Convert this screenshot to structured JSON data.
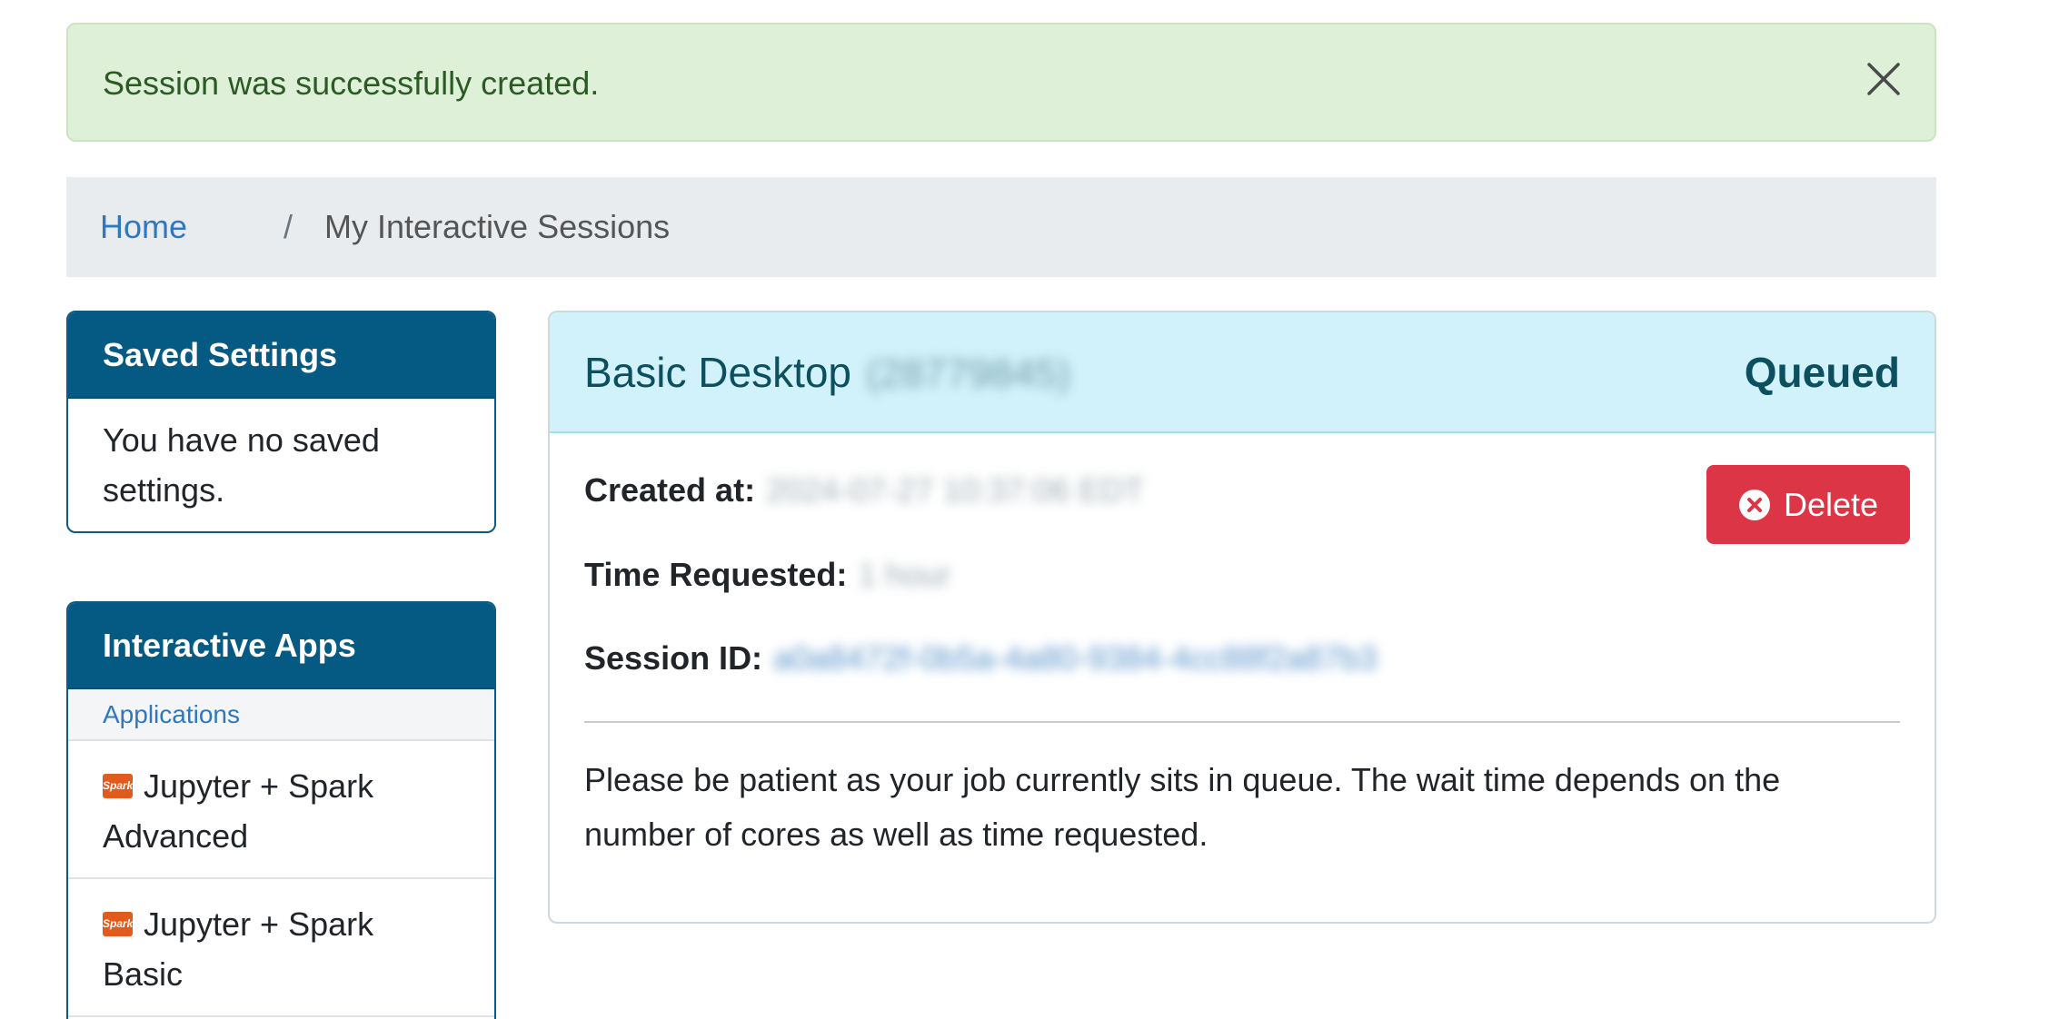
{
  "alert": {
    "message": "Session was successfully created.",
    "close_icon": "close-icon"
  },
  "breadcrumb": {
    "home": "Home",
    "separator": "/",
    "current": "My Interactive Sessions"
  },
  "saved_settings": {
    "title": "Saved Settings",
    "body": "You have no saved settings."
  },
  "interactive_apps": {
    "title": "Interactive Apps",
    "section_label": "Applications",
    "items": [
      {
        "label": "Jupyter + Spark Advanced",
        "icon": "spark-logo-icon"
      },
      {
        "label": "Jupyter + Spark Basic",
        "icon": "spark-logo-icon"
      }
    ]
  },
  "session": {
    "title": "Basic Desktop",
    "job_id": "(28779845)",
    "status": "Queued",
    "delete_label": "Delete",
    "created_label": "Created at:",
    "created_value": "2024-07-27 10:37:06 EDT",
    "time_label": "Time Requested:",
    "time_value": "1 hour",
    "id_label": "Session ID:",
    "id_value": "a0a8472f-0b5a-4a80-9384-4cc88f2a87b3",
    "note": "Please be patient as your job currently sits in queue. The wait time depends on the number of cores as well as time requested."
  },
  "colors": {
    "header": "#045a83",
    "danger": "#dc3545",
    "success_bg": "#dff0d8",
    "info_bg": "#d1f2fa",
    "link": "#2f78bf"
  }
}
